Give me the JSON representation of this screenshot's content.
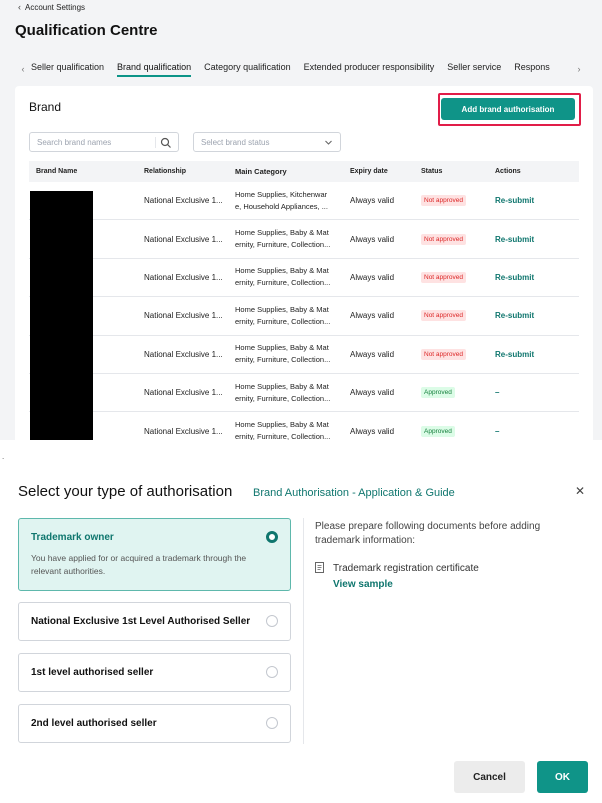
{
  "header": {
    "back_label": "Account Settings",
    "page_title": "Qualification Centre"
  },
  "tabs": [
    {
      "label": "Seller qualification",
      "active": false
    },
    {
      "label": "Brand qualification",
      "active": true
    },
    {
      "label": "Category qualification",
      "active": false
    },
    {
      "label": "Extended producer responsibility",
      "active": false
    },
    {
      "label": "Seller service",
      "active": false
    },
    {
      "label": "Respons",
      "active": false
    }
  ],
  "brand": {
    "title": "Brand",
    "add_button": "Add brand authorisation",
    "search_placeholder": "Search brand names",
    "status_placeholder": "Select brand status",
    "columns": [
      "Brand Name",
      "Relationship",
      "Main Category",
      "Expiry date",
      "Status",
      "Actions"
    ],
    "rows": [
      {
        "relationship": "National Exclusive 1...",
        "category_l1": "Home Supplies, Kitchenwar",
        "category_l2": "e, Household Appliances, ...",
        "expiry": "Always valid",
        "status": "Not approved",
        "action": "Re-submit"
      },
      {
        "relationship": "National Exclusive 1...",
        "category_l1": "Home Supplies, Baby & Mat",
        "category_l2": "ernity, Furniture, Collection...",
        "expiry": "Always valid",
        "status": "Not approved",
        "action": "Re-submit"
      },
      {
        "relationship": "National Exclusive 1...",
        "category_l1": "Home Supplies, Baby & Mat",
        "category_l2": "ernity, Furniture, Collection...",
        "expiry": "Always valid",
        "status": "Not approved",
        "action": "Re-submit"
      },
      {
        "relationship": "National Exclusive 1...",
        "category_l1": "Home Supplies, Baby & Mat",
        "category_l2": "ernity, Furniture, Collection...",
        "expiry": "Always valid",
        "status": "Not approved",
        "action": "Re-submit"
      },
      {
        "relationship": "National Exclusive 1...",
        "category_l1": "Home Supplies, Baby & Mat",
        "category_l2": "ernity, Furniture, Collection...",
        "expiry": "Always valid",
        "status": "Not approved",
        "action": "Re-submit"
      },
      {
        "relationship": "National Exclusive 1...",
        "category_l1": "Home Supplies, Baby & Mat",
        "category_l2": "ernity, Furniture, Collection...",
        "expiry": "Always valid",
        "status": "Approved",
        "action": "–"
      },
      {
        "relationship": "National Exclusive 1...",
        "category_l1": "Home Supplies, Baby & Mat",
        "category_l2": "ernity, Furniture, Collection...",
        "expiry": "Always valid",
        "status": "Approved",
        "action": "–"
      }
    ]
  },
  "modal": {
    "title": "Select your type of authorisation",
    "guide_link": "Brand Authorisation - Application & Guide",
    "options": [
      {
        "label": "Trademark owner",
        "description": "You have applied for or acquired a trademark through the relevant authorities.",
        "selected": true
      },
      {
        "label": "National Exclusive 1st Level Authorised Seller",
        "selected": false
      },
      {
        "label": "1st level authorised seller",
        "selected": false
      },
      {
        "label": "2nd level authorised seller",
        "selected": false
      }
    ],
    "prepare_text": "Please prepare following documents before adding trademark information:",
    "document_name": "Trademark registration certificate",
    "view_sample": "View sample",
    "cancel_label": "Cancel",
    "ok_label": "OK"
  },
  "colors": {
    "accent": "#0f9488",
    "highlight": "#e11d48",
    "not_approved": "#dc2626",
    "approved": "#15803d"
  },
  "icons": {
    "back": "chevron-left-icon",
    "search": "search-icon",
    "dropdown": "chevron-down-icon",
    "close": "close-icon",
    "document": "document-icon"
  }
}
